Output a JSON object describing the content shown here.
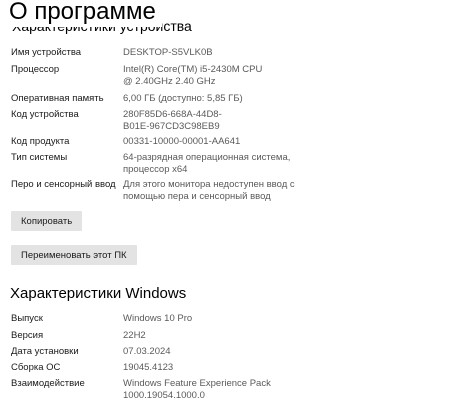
{
  "page_title": "О программе",
  "device_section": {
    "title": "Характеристики устройства",
    "rows": [
      {
        "label": "Имя устройства",
        "value": "DESKTOP-S5VLK0B"
      },
      {
        "label": "Процессор",
        "value": "Intel(R) Core(TM) i5-2430M CPU @ 2.40GHz   2.40 GHz"
      },
      {
        "label": "Оперативная память",
        "value": "6,00 ГБ (доступно: 5,85 ГБ)"
      },
      {
        "label": "Код устройства",
        "value": "280F85D6-668A-44D8-B01E-967CD3C98EB9"
      },
      {
        "label": "Код продукта",
        "value": "00331-10000-00001-AA641"
      },
      {
        "label": "Тип системы",
        "value": "64-разрядная операционная система, процессор x64"
      },
      {
        "label": "Перо и сенсорный ввод",
        "value": "Для этого монитора недоступен ввод с помощью пера и сенсорный ввод"
      }
    ],
    "copy_button": "Копировать",
    "rename_button": "Переименовать этот ПК"
  },
  "windows_section": {
    "title": "Характеристики Windows",
    "rows": [
      {
        "label": "Выпуск",
        "value": "Windows 10 Pro"
      },
      {
        "label": "Версия",
        "value": "22H2"
      },
      {
        "label": "Дата установки",
        "value": "07.03.2024"
      },
      {
        "label": "Сборка ОС",
        "value": "19045.4123"
      },
      {
        "label": "Взаимодействие",
        "value": "Windows Feature Experience Pack 1000.19054.1000.0"
      }
    ]
  }
}
